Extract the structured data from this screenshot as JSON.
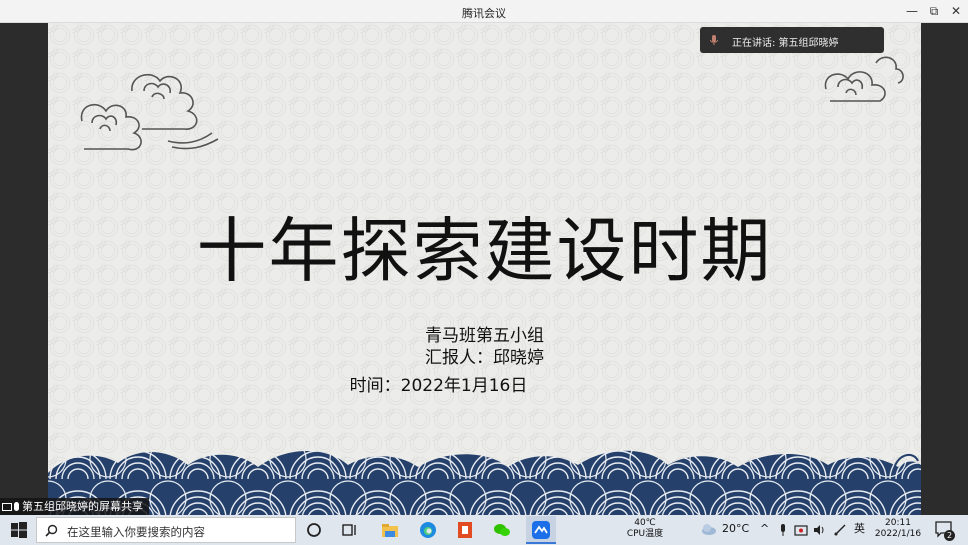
{
  "window": {
    "title": "腾讯会议",
    "minimize": "—",
    "restore": "⧉",
    "close": "✕"
  },
  "speaking": {
    "label": "正在讲话: 第五组邱晓婷"
  },
  "share_label": "第五组邱晓婷的屏幕共享",
  "slide": {
    "title": "十年探索建设时期",
    "line1": "青马班第五小组",
    "line2": "汇报人：邱晓婷",
    "line3": "时间：2022年1月16日"
  },
  "taskbar": {
    "search_placeholder": "在这里输入你要搜索的内容",
    "cpu_temp": "40℃",
    "cpu_label": "CPU温度",
    "weather": "20°C",
    "ime": "英",
    "time": "20:11",
    "date": "2022/1/16",
    "notifications": "2"
  }
}
